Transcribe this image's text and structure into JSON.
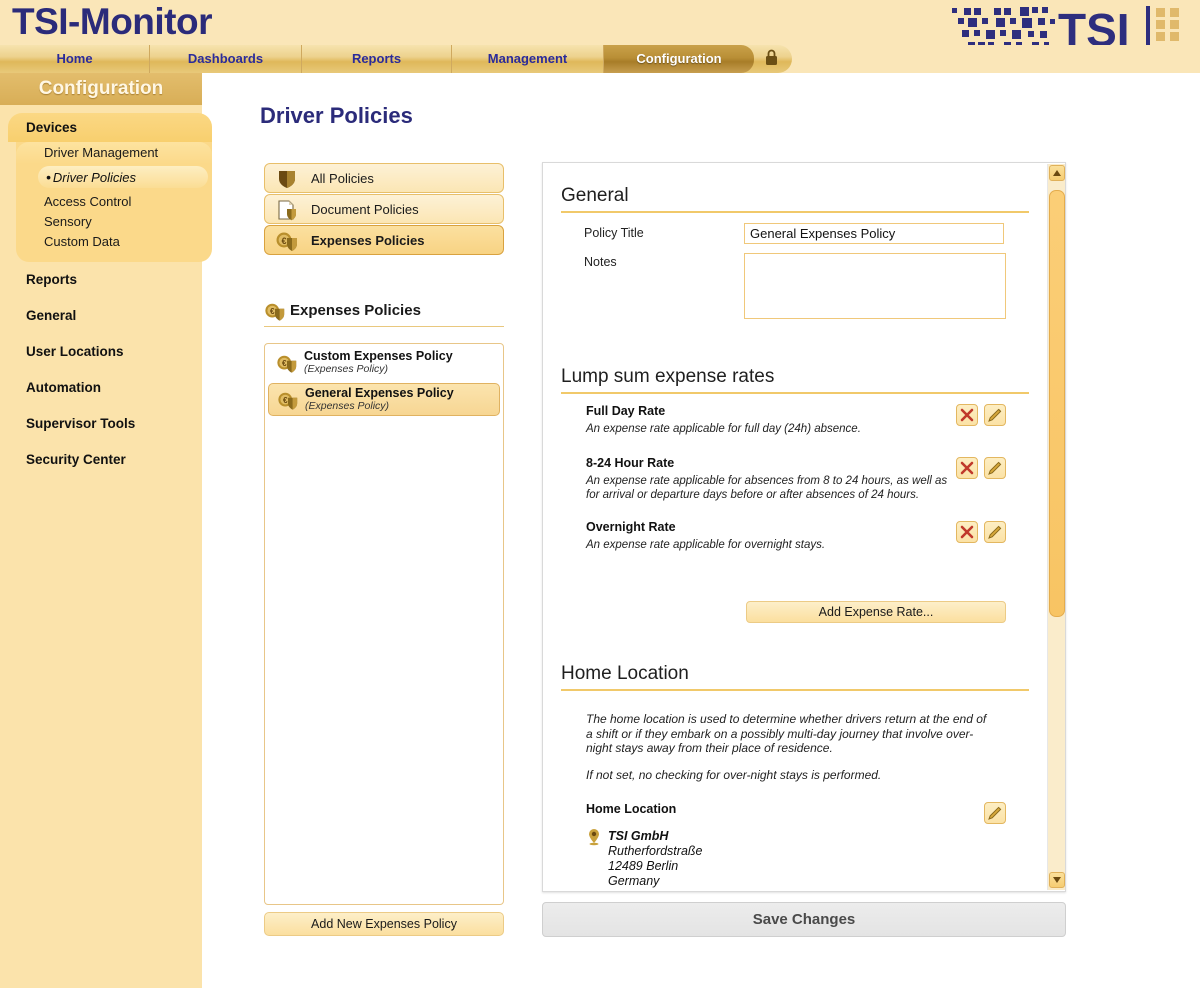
{
  "app": {
    "brand": "TSI-Monitor",
    "logo_text": "TSI"
  },
  "tabs": [
    {
      "label": "Home",
      "active": false
    },
    {
      "label": "Dashboards",
      "active": false
    },
    {
      "label": "Reports",
      "active": false
    },
    {
      "label": "Management",
      "active": false
    },
    {
      "label": "Configuration",
      "active": true
    }
  ],
  "lock_icon": "lock-icon",
  "sidebar": {
    "title": "Configuration",
    "group": {
      "label": "Devices",
      "sub_head": "Driver Management",
      "selected": "Driver Policies",
      "items": [
        "Access Control",
        "Sensory",
        "Custom Data"
      ]
    },
    "links": [
      "Reports",
      "General",
      "User Locations",
      "Automation",
      "Supervisor Tools",
      "Security Center"
    ]
  },
  "main": {
    "page_title": "Driver Policies",
    "policy_types": [
      {
        "label": "All Policies",
        "icon": "shield-icon",
        "active": false
      },
      {
        "label": "Document Policies",
        "icon": "document-shield-icon",
        "active": false
      },
      {
        "label": "Expenses Policies",
        "icon": "expenses-shield-icon",
        "active": true
      }
    ],
    "list_heading": "Expenses Policies",
    "policies": [
      {
        "name": "Custom Expenses Policy",
        "subtitle": "(Expenses Policy)",
        "selected": false
      },
      {
        "name": "General Expenses Policy",
        "subtitle": "(Expenses Policy)",
        "selected": true
      }
    ],
    "add_policy_label": "Add New Expenses Policy",
    "save_label": "Save Changes"
  },
  "detail": {
    "general": {
      "heading": "General",
      "policy_title_label": "Policy Title",
      "policy_title_value": "General Expenses Policy",
      "notes_label": "Notes",
      "notes_value": ""
    },
    "rates": {
      "heading": "Lump sum expense rates",
      "items": [
        {
          "name": "Full Day Rate",
          "description": "An expense rate applicable for full day (24h) absence."
        },
        {
          "name": "8-24 Hour Rate",
          "description": "An expense rate applicable for absences from 8 to 24 hours, as well as for arrival or departure days before or after absences of 24 hours."
        },
        {
          "name": "Overnight Rate",
          "description": "An expense rate applicable for overnight stays."
        }
      ],
      "add_label": "Add Expense Rate...",
      "delete_icon": "delete-x-icon",
      "edit_icon": "edit-pencil-icon"
    },
    "home_location": {
      "heading": "Home Location",
      "paragraph1": "The home location is used to determine whether drivers return at the end of a shift or if they embark on a possibly multi-day journey that involve over-night stays away from their place of residence.",
      "paragraph2": "If not set, no checking for over-night stays is performed.",
      "field_label": "Home Location",
      "pin_icon": "map-pin-icon",
      "edit_icon": "edit-pencil-icon",
      "address": {
        "name": "TSI GmbH",
        "street": "Rutherfordstraße",
        "city": "12489 Berlin",
        "country": "Germany"
      }
    }
  },
  "colors": {
    "brand_navy": "#2b2b7a",
    "header_cream": "#fae6b8",
    "sidebar_cream": "#fbe3ab",
    "accent_gold": "#f1c96a",
    "active_tab": "#b98f36",
    "delete_red": "#c0392b"
  }
}
